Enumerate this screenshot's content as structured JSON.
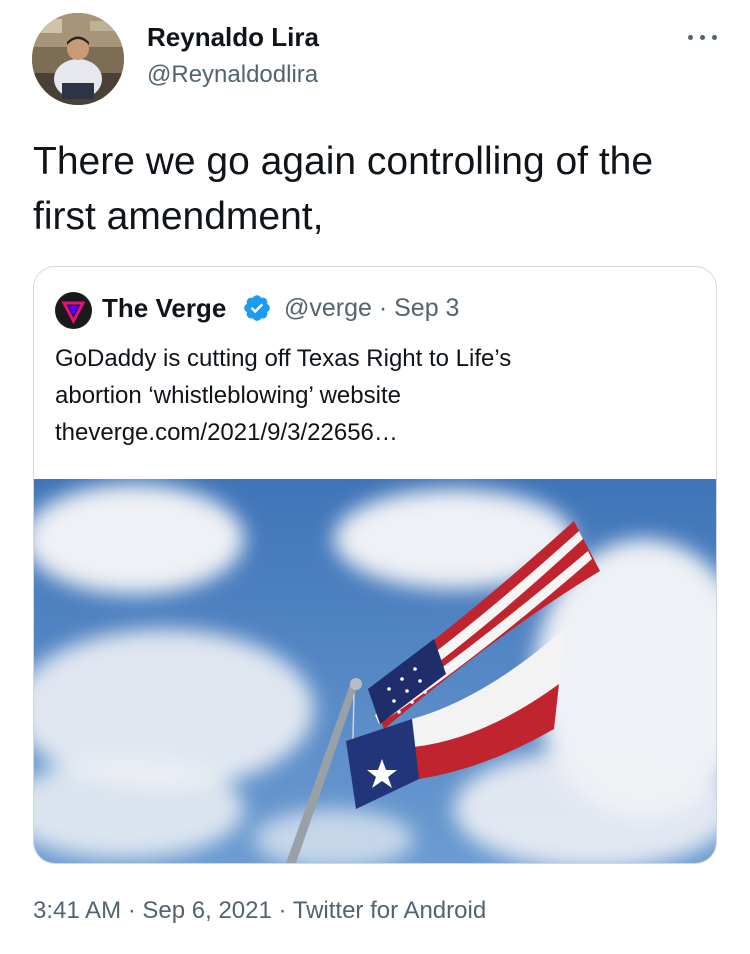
{
  "author": {
    "name": "Reynaldo Lira",
    "handle": "@Reynaldodlira",
    "avatar": "profile-photo"
  },
  "more_icon": "more-horizontal-icon",
  "tweet_text": "There we go again controlling of the first amendment,",
  "quoted_tweet": {
    "name": "The Verge",
    "handle_and_date": "@verge · Sep 3",
    "verified": true,
    "logo_icon": "verge-logo-icon",
    "badge_icon": "verified-badge-icon",
    "text_line1": "GoDaddy is cutting off Texas Right to Life’s",
    "text_line2": "abortion ‘whistleblowing’ website",
    "link": "theverge.com/2021/9/3/22656…",
    "image": "us-and-texas-flags-against-cloudy-sky"
  },
  "meta": {
    "time": "3:41 AM",
    "date": "Sep 6, 2021",
    "source": "Twitter for Android",
    "separator": " · "
  },
  "colors": {
    "text": "#0f1419",
    "secondary": "#536471",
    "verified": "#1d9bf0",
    "border": "#cfd9de",
    "sky": "#4f84c2"
  }
}
